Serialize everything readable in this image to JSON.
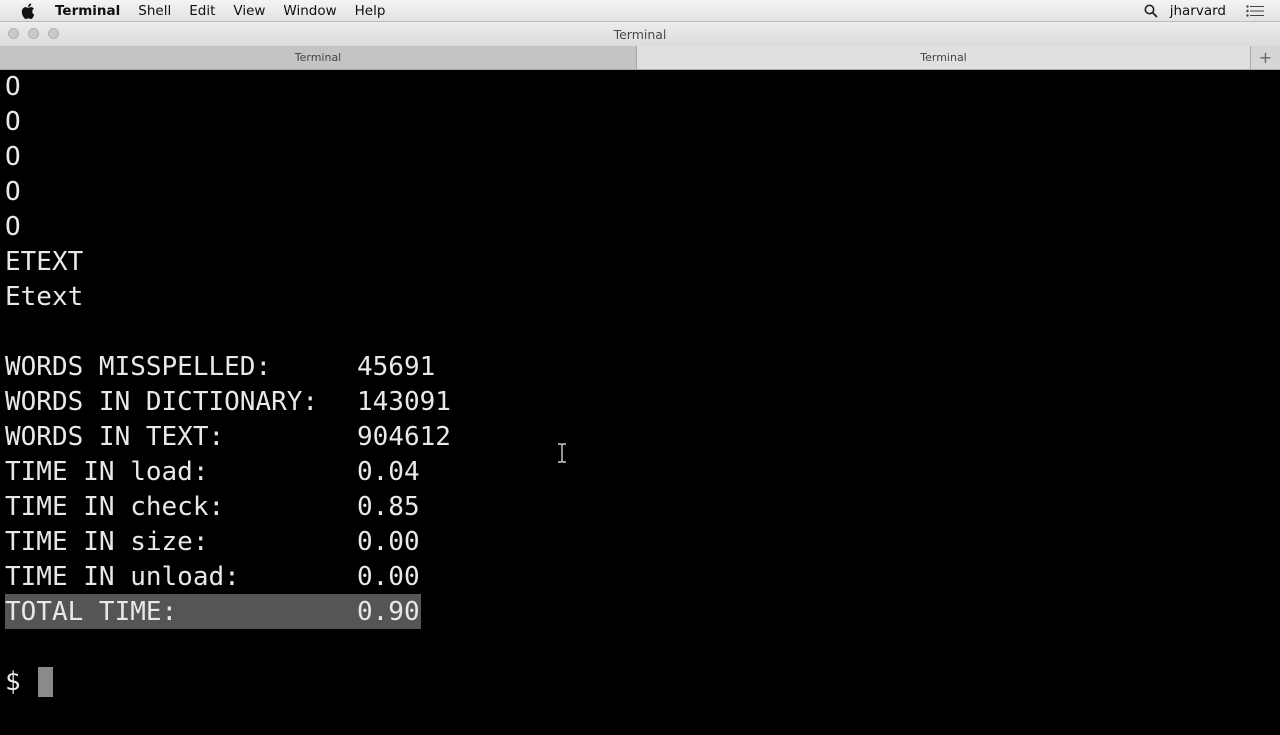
{
  "menubar": {
    "app_name": "Terminal",
    "items": [
      "Shell",
      "Edit",
      "View",
      "Window",
      "Help"
    ],
    "user": "jharvard",
    "icons": [
      "apple-icon",
      "search-icon",
      "list-icon"
    ]
  },
  "window": {
    "title": "Terminal"
  },
  "tabs": [
    "Terminal",
    "Terminal"
  ],
  "terminal": {
    "output_lines": [
      "O",
      "O",
      "O",
      "O",
      "O",
      "ETEXT",
      "Etext"
    ],
    "stats": [
      {
        "label": "WORDS MISSPELLED:",
        "value": "45691"
      },
      {
        "label": "WORDS IN DICTIONARY:",
        "value": "143091"
      },
      {
        "label": "WORDS IN TEXT:",
        "value": "904612"
      },
      {
        "label": "TIME IN load:",
        "value": "0.04"
      },
      {
        "label": "TIME IN check:",
        "value": "0.85"
      },
      {
        "label": "TIME IN size:",
        "value": "0.00"
      },
      {
        "label": "TIME IN unload:",
        "value": "0.00"
      },
      {
        "label": "TOTAL TIME:",
        "value": "0.90"
      }
    ],
    "prompt": "$"
  },
  "colors": {
    "background": "#000000",
    "text": "#e8e8e8",
    "selection": "#555555"
  }
}
